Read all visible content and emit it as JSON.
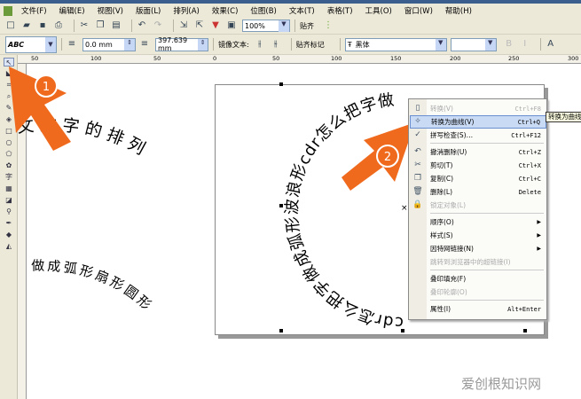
{
  "menubar": [
    "文件(F)",
    "编辑(E)",
    "视图(V)",
    "版面(L)",
    "排列(A)",
    "效果(C)",
    "位图(B)",
    "文本(T)",
    "表格(T)",
    "工具(O)",
    "窗口(W)",
    "帮助(H)"
  ],
  "toolbar": {
    "zoom": "100%",
    "snap": "贴齐"
  },
  "propbar": {
    "offset": "0.0 mm",
    "length": "397.639 mm",
    "mirror_label": "镜像文本:",
    "snap_marks": "贴齐标记",
    "font": "黑体",
    "font_size": ""
  },
  "ruler_ticks": [
    "50",
    "100",
    "50",
    "0",
    "50",
    "100",
    "150",
    "200",
    "250",
    "300"
  ],
  "canvas": {
    "arc_text_1": "文文字的排列",
    "arc_text_2": "做成弧形扇形圆形",
    "circle_text": "cdr怎么把字做成弧形波浪形cdr怎么把字做"
  },
  "callouts": [
    "1",
    "2"
  ],
  "context_menu": [
    {
      "label": "转换(V)",
      "shortcut": "Ctrl+F8",
      "disabled": true
    },
    {
      "label": "转换为曲线(V)",
      "shortcut": "Ctrl+Q",
      "highlighted": true
    },
    {
      "label": "拼写检查(S)…",
      "shortcut": "Ctrl+F12"
    },
    {
      "label": "撤消删除(U)",
      "shortcut": "Ctrl+Z"
    },
    {
      "label": "剪切(T)",
      "shortcut": "Ctrl+X"
    },
    {
      "label": "复制(C)",
      "shortcut": "Ctrl+C"
    },
    {
      "label": "删除(L)",
      "shortcut": "Delete"
    },
    {
      "label": "锁定对象(L)",
      "shortcut": "",
      "disabled": true
    },
    {
      "label": "顺序(O)",
      "shortcut": "",
      "submenu": true
    },
    {
      "label": "样式(S)",
      "shortcut": "",
      "submenu": true
    },
    {
      "label": "因特网链接(N)",
      "shortcut": "",
      "submenu": true
    },
    {
      "label": "跳转到浏览器中的超链接(I)",
      "shortcut": "",
      "disabled": true
    },
    {
      "label": "叠印填充(F)",
      "shortcut": ""
    },
    {
      "label": "叠印轮廓(O)",
      "shortcut": "",
      "disabled": true
    },
    {
      "label": "属性(I)",
      "shortcut": "Alt+Enter"
    }
  ],
  "tooltip": "转换为曲线",
  "watermark": "爱创根知识网",
  "colors": {
    "accent_arrow": "#f06a1e",
    "menu_highlight": "#c9daf5",
    "chrome": "#ece9d8"
  }
}
